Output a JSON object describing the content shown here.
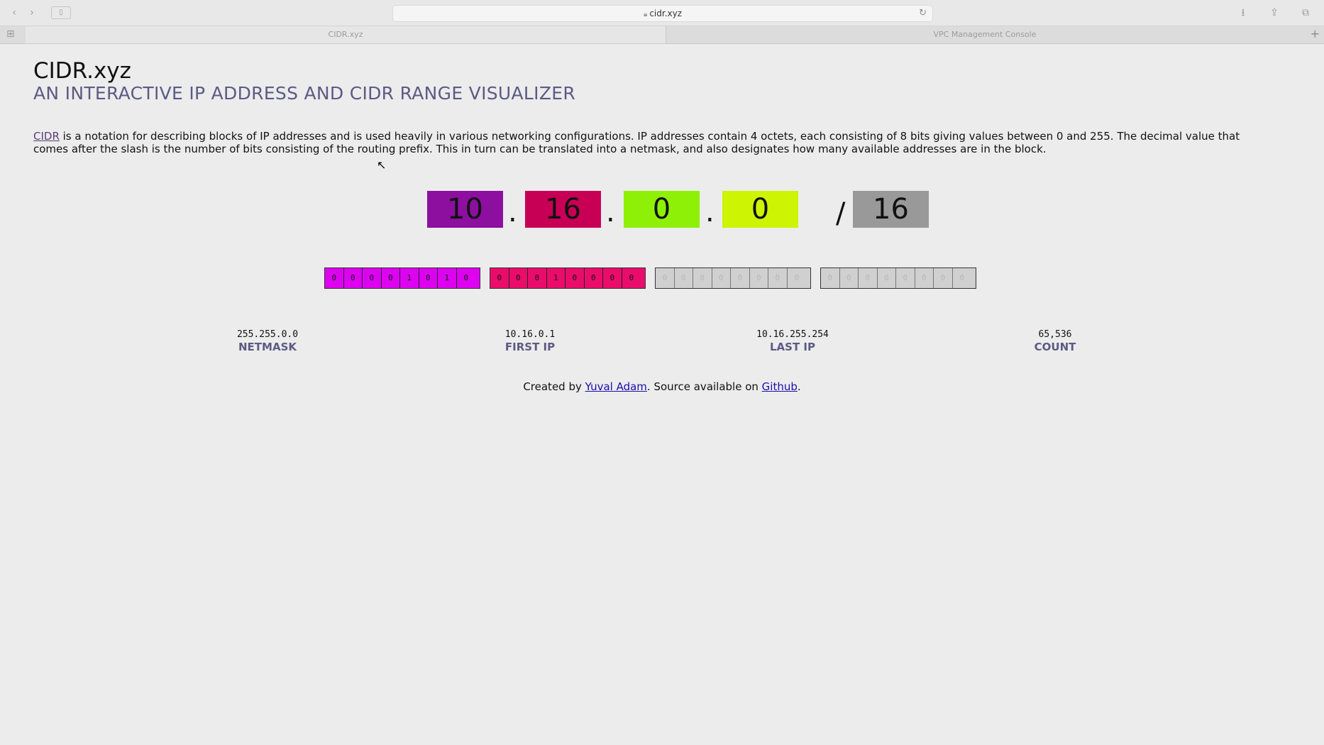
{
  "browser": {
    "url": "cidr.xyz",
    "tabs": [
      {
        "label": "CIDR.xyz",
        "active": true
      },
      {
        "label": "VPC Management Console",
        "active": false
      }
    ]
  },
  "page": {
    "title": "CIDR.xyz",
    "subtitle": "AN INTERACTIVE IP ADDRESS AND CIDR RANGE VISUALIZER",
    "intro_link": "CIDR",
    "intro_text": " is a notation for describing blocks of IP addresses and is used heavily in various networking configurations. IP addresses contain 4 octets, each consisting of 8 bits giving values between 0 and 255. The decimal value that comes after the slash is the number of bits consisting of the routing prefix. This in turn can be translated into a netmask, and also designates how many available addresses are in the block."
  },
  "cidr": {
    "octets": [
      "10",
      "16",
      "0",
      "0"
    ],
    "dot": ".",
    "slash": "/",
    "prefix": "16",
    "colors": {
      "octet1": "#8c0fa0",
      "octet2": "#c70055",
      "octet3": "#8ef007",
      "octet4": "#cdf403",
      "prefix": "#999999",
      "bits1": "#dd02f0",
      "bits2": "#ea0c6a",
      "bits_masked": "#d0d0d0"
    }
  },
  "bits": [
    [
      "0",
      "0",
      "0",
      "0",
      "1",
      "0",
      "1",
      "0"
    ],
    [
      "0",
      "0",
      "0",
      "1",
      "0",
      "0",
      "0",
      "0"
    ],
    [
      "0",
      "0",
      "0",
      "0",
      "0",
      "0",
      "0",
      "0"
    ],
    [
      "0",
      "0",
      "0",
      "0",
      "0",
      "0",
      "0",
      "0"
    ]
  ],
  "stats": {
    "netmask": {
      "value": "255.255.0.0",
      "label": "NETMASK"
    },
    "first_ip": {
      "value": "10.16.0.1",
      "label": "FIRST IP"
    },
    "last_ip": {
      "value": "10.16.255.254",
      "label": "LAST IP"
    },
    "count": {
      "value": "65,536",
      "label": "COUNT"
    }
  },
  "footer": {
    "prefix": "Created by ",
    "author": "Yuval Adam",
    "middle": ". Source available on ",
    "source": "Github",
    "suffix": "."
  }
}
